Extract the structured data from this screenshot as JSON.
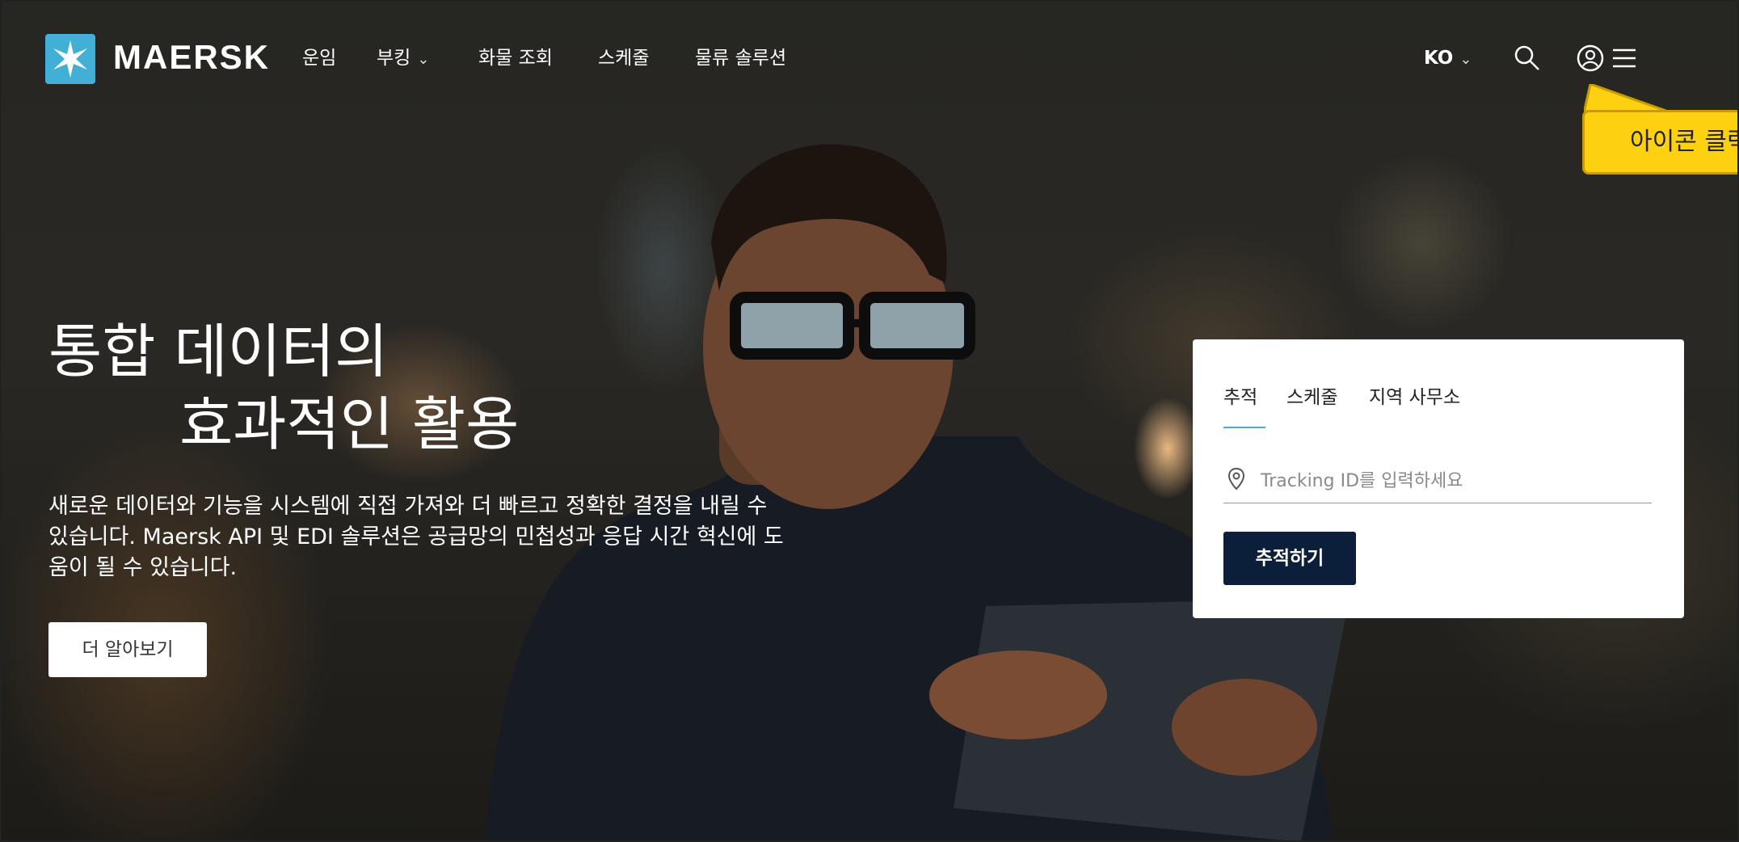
{
  "header": {
    "logo_text": "MAERSK",
    "nav_items": [
      "운임",
      "부킹",
      "화물 조회",
      "스케줄",
      "물류 솔루션"
    ],
    "language": "KO",
    "icons": [
      "chevron-down-icon",
      "search-icon",
      "user-icon",
      "menu-icon"
    ]
  },
  "tooltip": {
    "text": "아이콘 클릭"
  },
  "hero": {
    "title_line1": "통합 데이터의",
    "title_line2": "효과적인 활용",
    "description": "새로운 데이터와 기능을 시스템에 직접 가져와 더 빠르고 정확한 결정을 내릴 수 있습니다. Maersk API 및 EDI 솔루션은 공급망의 민첩성과 응답 시간 혁신에 도움이 될 수 있습니다.",
    "learn_more": "더 알아보기"
  },
  "tracking_card": {
    "tabs": [
      "추적",
      "스케줄",
      "지역 사무소"
    ],
    "active_tab": "추적",
    "input_placeholder": "Tracking ID를 입력하세요",
    "input_value": "",
    "button_label": "추적하기"
  },
  "colors": {
    "brand_blue": "#42b0d5",
    "button_navy": "#0b1f3a",
    "tooltip_yellow": "#fdd10f"
  }
}
